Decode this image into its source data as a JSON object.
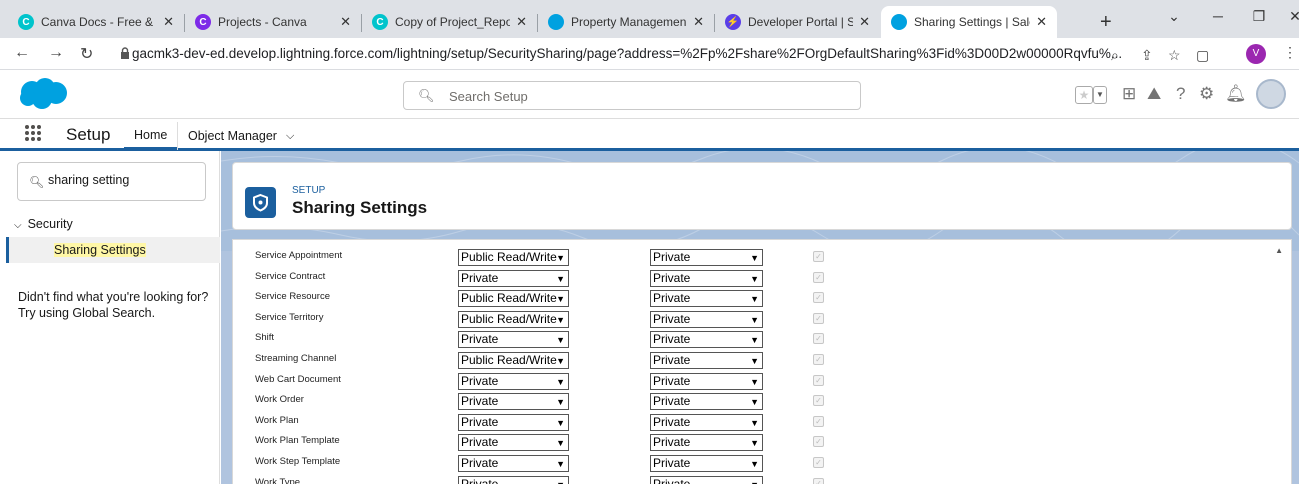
{
  "browser": {
    "tabs": [
      {
        "label": "Canva Docs - Free & E",
        "icon_color": "#00c4cc",
        "icon_char": "C"
      },
      {
        "label": "Projects - Canva",
        "icon_color": "#7d2ae8",
        "icon_char": "C"
      },
      {
        "label": "Copy of Project_Repo",
        "icon_color": "#00c4cc",
        "icon_char": "C"
      },
      {
        "label": "Property Managemen",
        "icon_color": "#00a1e0",
        "icon_char": ""
      },
      {
        "label": "Developer Portal | Sale",
        "icon_color": "#5a3ee8",
        "icon_char": "⚡"
      },
      {
        "label": "Sharing Settings | Sale",
        "icon_color": "#00a1e0",
        "icon_char": ""
      }
    ],
    "new_tab": "+",
    "url": "gacmk3-dev-ed.develop.lightning.force.com/lightning/setup/SecuritySharing/page?address=%2Fp%2Fshare%2FOrgDefaultSharing%3Fid%3D00D2w00000Rqvfu%...",
    "profile_initial": "V"
  },
  "sf": {
    "search_placeholder": "Search Setup",
    "app_title": "Setup",
    "tab_home": "Home",
    "tab_object_manager": "Object Manager",
    "brand_color": "#1b5f9e"
  },
  "sidebar": {
    "quick_find_value": "sharing setting",
    "section": "Security",
    "item": "Sharing Settings",
    "not_found_line1": "Didn't find what you're looking for?",
    "not_found_line2": "Try using Global Search."
  },
  "page": {
    "subtitle": "SETUP",
    "title": "Sharing Settings"
  },
  "rows": [
    {
      "label": "Service Appointment",
      "internal": "Public Read/Write",
      "external": "Private"
    },
    {
      "label": "Service Contract",
      "internal": "Private",
      "external": "Private"
    },
    {
      "label": "Service Resource",
      "internal": "Public Read/Write",
      "external": "Private"
    },
    {
      "label": "Service Territory",
      "internal": "Public Read/Write",
      "external": "Private"
    },
    {
      "label": "Shift",
      "internal": "Private",
      "external": "Private"
    },
    {
      "label": "Streaming Channel",
      "internal": "Public Read/Write",
      "external": "Private"
    },
    {
      "label": "Web Cart Document",
      "internal": "Private",
      "external": "Private"
    },
    {
      "label": "Work Order",
      "internal": "Private",
      "external": "Private"
    },
    {
      "label": "Work Plan",
      "internal": "Private",
      "external": "Private"
    },
    {
      "label": "Work Plan Template",
      "internal": "Private",
      "external": "Private"
    },
    {
      "label": "Work Step Template",
      "internal": "Private",
      "external": "Private"
    },
    {
      "label": "Work Type",
      "internal": "Private",
      "external": "Private"
    }
  ]
}
